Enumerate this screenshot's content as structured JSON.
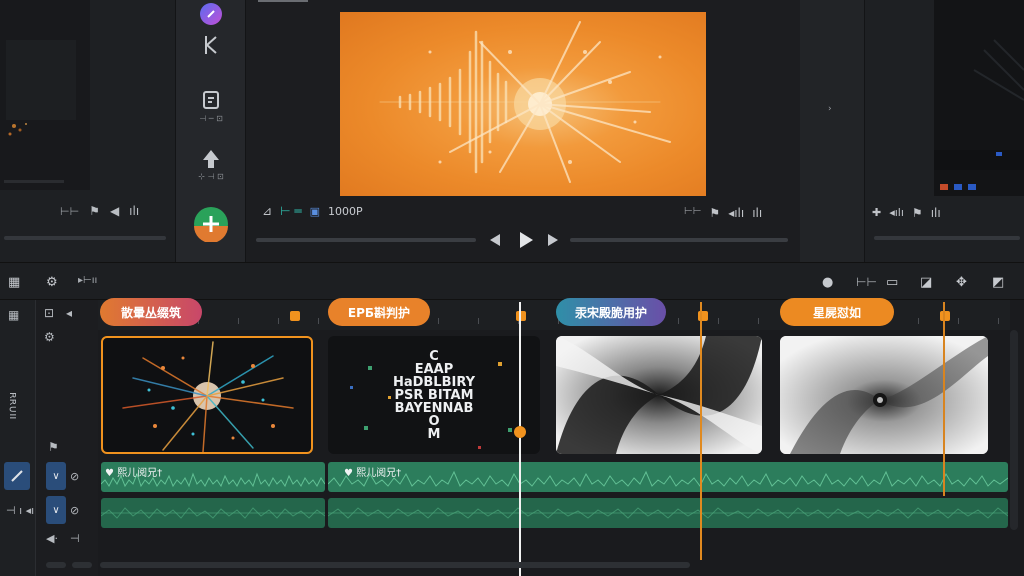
{
  "viewer": {
    "resolution": "1000P"
  },
  "tool_rail": {
    "items": [
      {
        "name": "color-orb",
        "label": ""
      },
      {
        "name": "cut-tool",
        "label": ""
      },
      {
        "name": "text-tool",
        "label": "⊣ ─ ⊡"
      },
      {
        "name": "effects-tool",
        "label": "⊹ ⊣ ⊡"
      },
      {
        "name": "add",
        "label": ""
      }
    ]
  },
  "track_header": {
    "label": "ıı∩ᴚᴚ"
  },
  "clips": [
    {
      "title": "散暈丛缀筑",
      "color": "#e0783c"
    },
    {
      "title": "ЕРБ斟判护",
      "color": "#e8822a"
    },
    {
      "title": "汞宋殿脆用护",
      "color": "#6a4fa8"
    },
    {
      "title": "星屍怼如",
      "color": "#ec8a22"
    }
  ],
  "text_clip": {
    "lines": [
      "C",
      "EAAP",
      "HaDBLBIRY",
      "PSR BITAM",
      "BAYENNAB",
      "O",
      "M"
    ]
  },
  "audio": {
    "label_1": "♥ 熙儿阅兄†",
    "label_2": "♥ 熙儿阅兄†"
  },
  "colors": {
    "accent": "#f0921e",
    "audio_green": "#2c7d5c",
    "video_orange": "#ec8a2a"
  }
}
